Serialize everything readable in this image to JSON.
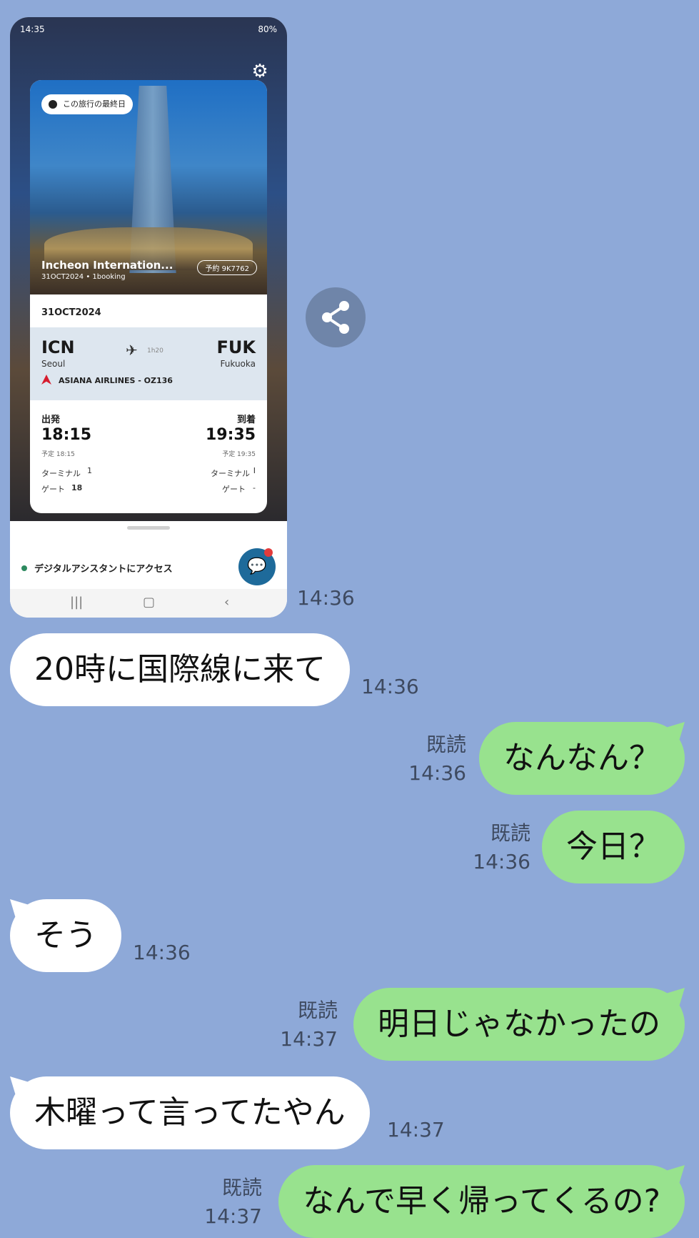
{
  "screenshot": {
    "status_time": "14:35",
    "status_right": "80%",
    "warning_pill": "この旅行の最終日",
    "airport_title": "Incheon Internation...",
    "airport_sub": "31OCT2024 • 1booking",
    "booking_ref": "予約 9K7762",
    "date": "31OCT2024",
    "from_code": "ICN",
    "from_city": "Seoul",
    "to_code": "FUK",
    "to_city": "Fukuoka",
    "duration": "1h20",
    "airline": "ASIANA AIRLINES - OZ136",
    "depart_label": "出発",
    "arrive_label": "到着",
    "depart_time": "18:15",
    "arrive_time": "19:35",
    "depart_sched": "予定 18:15",
    "arrive_sched": "予定 19:35",
    "terminal_label": "ターミナル",
    "depart_terminal": "1",
    "arrive_terminal": "I",
    "gate_label": "ゲート",
    "depart_gate": "18",
    "arrive_gate": "-",
    "assistant_text": "デジタルアシスタントにアクセス",
    "nav_recent": "|||",
    "nav_home": "▢",
    "nav_back": "‹"
  },
  "messages": [
    {
      "side": "in",
      "type": "image",
      "time": "14:36"
    },
    {
      "side": "in",
      "text": "20時に国際線に来て",
      "time": "14:36"
    },
    {
      "side": "out",
      "text": "なんなん？",
      "read": "既読",
      "time": "14:36"
    },
    {
      "side": "out",
      "text": "今日？",
      "read": "既読",
      "time": "14:36"
    },
    {
      "side": "in",
      "text": "そう",
      "time": "14:36"
    },
    {
      "side": "out",
      "text": "明日じゃなかったの",
      "read": "既読",
      "time": "14:37"
    },
    {
      "side": "in",
      "text": "木曜って言ってたやん",
      "time": "14:37"
    },
    {
      "side": "out",
      "text": "なんで早く帰ってくるの?",
      "read": "既読",
      "time": "14:37"
    }
  ],
  "colors": {
    "background": "#8ea9d8",
    "incoming_bubble": "#ffffff",
    "outgoing_bubble": "#98e28e",
    "meta_text": "#3e4a60"
  },
  "icons": [
    "share-icon",
    "gear-icon",
    "plane-icon",
    "chat-assistant-icon"
  ]
}
